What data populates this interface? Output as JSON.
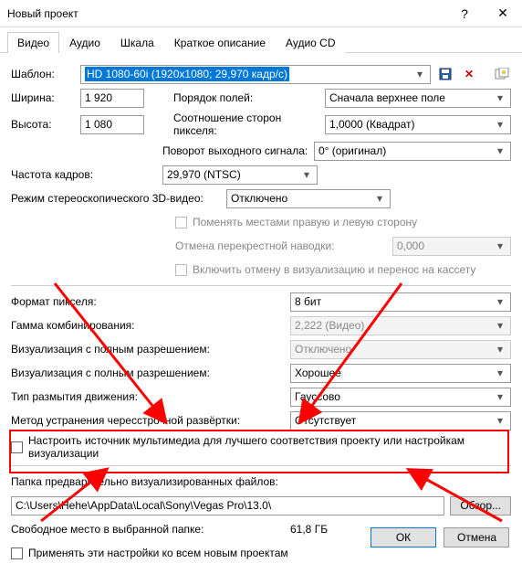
{
  "window": {
    "title": "Новый проект"
  },
  "tabs": [
    "Видео",
    "Аудио",
    "Шкала",
    "Краткое описание",
    "Аудио CD"
  ],
  "template": {
    "label": "Шаблон:",
    "value": "HD 1080-60i (1920x1080; 29,970 кадр/с)"
  },
  "width": {
    "label": "Ширина:",
    "value": "1 920"
  },
  "height": {
    "label": "Высота:",
    "value": "1 080"
  },
  "fieldorder": {
    "label": "Порядок полей:",
    "value": "Сначала верхнее поле"
  },
  "par": {
    "label": "Соотношение сторон пикселя:",
    "value": "1,0000 (Квадрат)"
  },
  "rotation": {
    "label": "Поворот выходного сигнала:",
    "value": "0° (оригинал)"
  },
  "framerate": {
    "label": "Частота кадров:",
    "value": "29,970 (NTSC)"
  },
  "stereo": {
    "label": "Режим стереоскопического 3D-видео:",
    "value": "Отключено"
  },
  "swap": {
    "label": "Поменять местами правую и левую сторону"
  },
  "crosstalk": {
    "label": "Отмена перекрестной наводки:",
    "value": "0,000"
  },
  "include": {
    "label": "Включить отмену в визуализацию и перенос на кассету"
  },
  "pixfmt": {
    "label": "Формат пикселя:",
    "value": "8 бит"
  },
  "gamma": {
    "label": "Гамма комбинирования:",
    "value": "2,222 (Видео)"
  },
  "fullres1": {
    "label": "Визуализация с полным разрешением:",
    "value": "Отключено"
  },
  "fullres2": {
    "label": "Визуализация с полным разрешением:",
    "value": "Хорошее"
  },
  "motionblur": {
    "label": "Тип размытия движения:",
    "value": "Гауссово"
  },
  "deinterlace": {
    "label": "Метод устранения чересстрочной развёртки:",
    "value": "Отсутствует"
  },
  "adjustsrc": {
    "label": "Настроить источник мультимедиа для лучшего соответствия проекту или настройкам визуализации"
  },
  "prerender": {
    "label": "Папка предварительно визуализированных файлов:",
    "path": "C:\\Users\\Hehe\\AppData\\Local\\Sony\\Vegas Pro\\13.0\\",
    "browse": "Обзор..."
  },
  "freespace": {
    "label": "Свободное место в выбранной папке:",
    "value": "61,8 ГБ"
  },
  "applyall": {
    "label": "Применять эти настройки ко всем новым проектам"
  },
  "buttons": {
    "ok": "ОК",
    "cancel": "Отмена"
  }
}
